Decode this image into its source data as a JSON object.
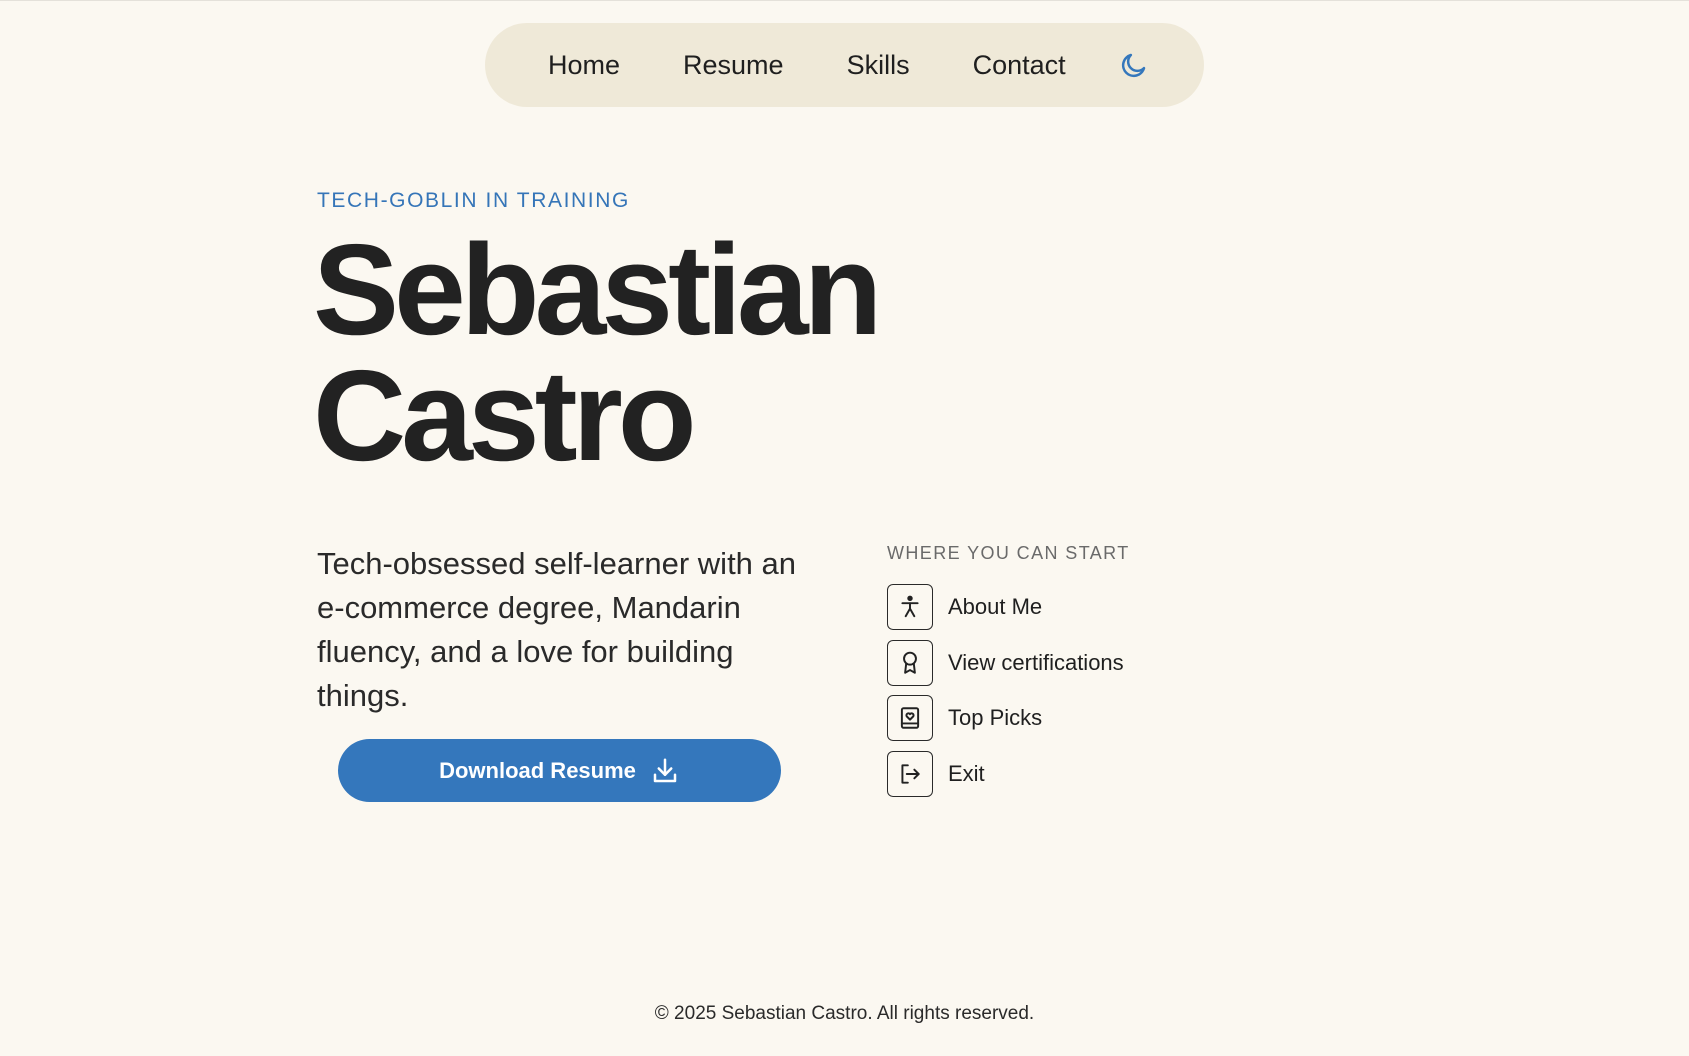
{
  "nav": {
    "items": [
      {
        "label": "Home"
      },
      {
        "label": "Resume"
      },
      {
        "label": "Skills"
      },
      {
        "label": "Contact"
      }
    ],
    "theme_toggle_icon": "moon-icon"
  },
  "hero": {
    "eyebrow": "TECH-GOBLIN IN TRAINING",
    "first_name": "Sebastian",
    "last_name": "Castro",
    "bio": "Tech-obsessed self-learner with an e-commerce degree, Mandarin fluency, and a love for building things.",
    "download_label": "Download Resume",
    "download_icon": "download-icon"
  },
  "start": {
    "heading": "WHERE YOU CAN START",
    "items": [
      {
        "label": "About Me",
        "icon": "person-icon"
      },
      {
        "label": "View certifications",
        "icon": "award-icon"
      },
      {
        "label": "Top Picks",
        "icon": "heart-book-icon"
      },
      {
        "label": "Exit",
        "icon": "exit-icon"
      }
    ]
  },
  "footer": {
    "copyright": "© 2025 Sebastian Castro. All rights reserved."
  },
  "colors": {
    "background": "#fbf8f1",
    "nav_background": "#efe9d8",
    "accent": "#3477bc",
    "text": "#222222"
  }
}
